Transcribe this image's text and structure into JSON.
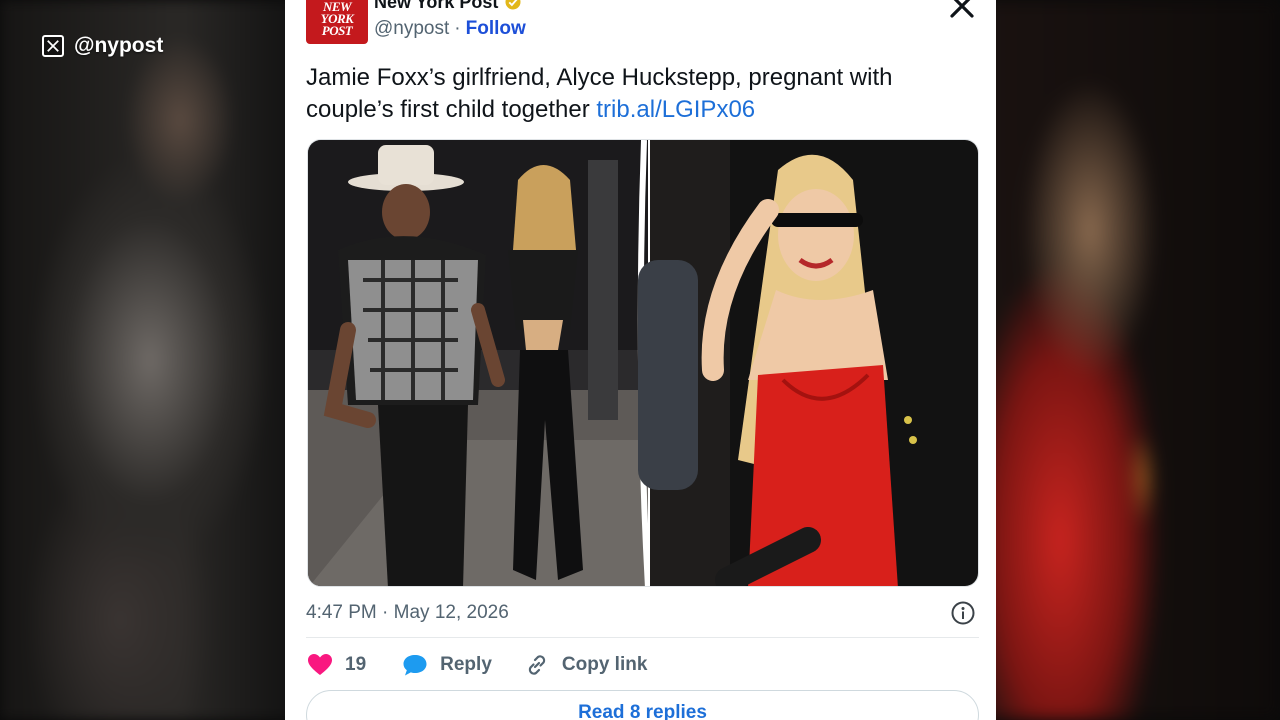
{
  "overlay": {
    "handle": "@nypost"
  },
  "tweet": {
    "avatar_text": [
      "NEW",
      "YORK",
      "POST"
    ],
    "display_name": "New York Post",
    "handle": "@nypost",
    "separator": "·",
    "follow_label": "Follow",
    "text": "Jamie Foxx’s girlfriend, Alyce Huckstepp, pregnant with couple’s first child together",
    "link": "trib.al/LGIPx06",
    "timestamp": "4:47 PM · May 12, 2026",
    "likes_count": "19",
    "reply_label": "Reply",
    "copy_link_label": "Copy link",
    "read_replies_label": "Read 8 replies"
  },
  "colors": {
    "brand_red": "#c4191d",
    "link_blue": "#1d6fd8",
    "heart": "#f91880",
    "reply_bubble": "#1d9bf0",
    "dress_red": "#d8201b"
  },
  "icons": {
    "x_logo": "x-logo-icon",
    "verified": "verified-badge-icon",
    "close": "close-icon",
    "info": "info-icon",
    "heart": "heart-icon",
    "reply": "reply-bubble-icon",
    "link": "link-icon"
  }
}
